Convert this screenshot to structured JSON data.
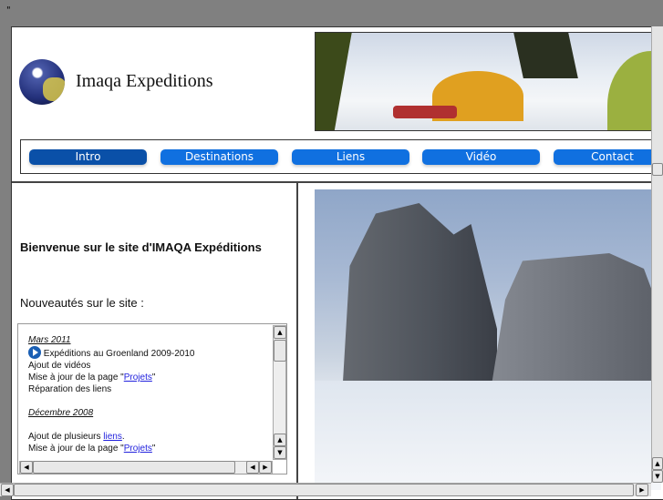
{
  "stray_text": "\"",
  "header": {
    "site_title": "Imaqa Expeditions"
  },
  "nav": [
    {
      "label": "Intro",
      "active": true
    },
    {
      "label": "Destinations"
    },
    {
      "label": "Liens"
    },
    {
      "label": "Vidéo"
    },
    {
      "label": "Contact"
    }
  ],
  "main": {
    "welcome": "Bienvenue sur le site d'IMAQA Expéditions",
    "news_heading": "Nouveautés sur le site :",
    "news": {
      "section1_date": "Mars 2011",
      "item1": "Expéditions au Groenland 2009-2010",
      "item2": "Ajout de vidéos",
      "item3_prefix": "Mise à jour de la page \"",
      "item3_link": "Projets",
      "item3_suffix": "\"",
      "item4": "Réparation des liens",
      "section2_date": "Décembre 2008",
      "item5_prefix": "Ajout de plusieurs ",
      "item5_link": "liens",
      "item5_suffix": ".",
      "item6_prefix": "Mise à jour de la page \"",
      "item6_link": "Projets",
      "item6_suffix": "\""
    }
  },
  "colors": {
    "background": "#808080",
    "nav_button": "#1070e0",
    "nav_active": "#0a50a8",
    "link": "#2222dd"
  }
}
